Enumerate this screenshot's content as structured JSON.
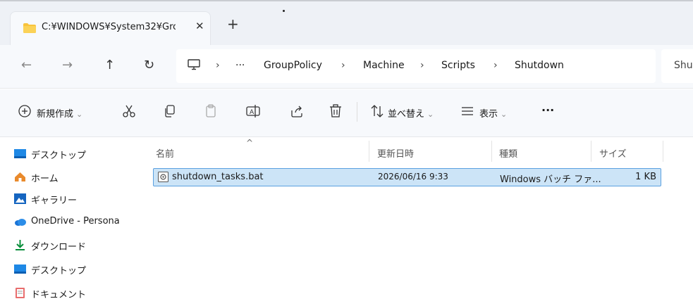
{
  "tab": {
    "title": "C:¥WINDOWS¥System32¥Gro",
    "close_glyph": "✕",
    "new_tab_glyph": "+",
    "icon": "folder-icon"
  },
  "nav": {
    "back_glyph": "←",
    "forward_glyph": "→",
    "up_glyph": "↑",
    "refresh_glyph": "↻",
    "more_glyph": "···",
    "breadcrumbs": [
      "GroupPolicy",
      "Machine",
      "Scripts",
      "Shutdown"
    ],
    "separator": "›",
    "search_placeholder": "Shu"
  },
  "toolbar": {
    "new_label": "新規作成",
    "sort_label": "並べ替え",
    "view_label": "表示",
    "more_glyph": "···",
    "caret": "⌄"
  },
  "sidebar": {
    "items": [
      {
        "label": "デスクトップ",
        "icon": "desktop-icon"
      },
      {
        "label": "ホーム",
        "icon": "home-icon"
      },
      {
        "label": "ギャラリー",
        "icon": "gallery-icon"
      },
      {
        "label": "OneDrive - Persona",
        "icon": "onedrive-icon"
      },
      {
        "label": "ダウンロード",
        "icon": "download-icon"
      },
      {
        "label": "デスクトップ",
        "icon": "desktop-icon"
      },
      {
        "label": "ドキュメント",
        "icon": "documents-icon"
      }
    ]
  },
  "columns": {
    "name": "名前",
    "modified": "更新日時",
    "type": "種類",
    "size": "サイズ",
    "sort_caret": "^"
  },
  "files": [
    {
      "name": "shutdown_tasks.bat",
      "modified": "2026/06/16 9:33",
      "type": "Windows バッチ ファ...",
      "size": "1 KB",
      "icon": "batch-file-icon"
    }
  ],
  "colors": {
    "accent": "#0067c0",
    "selection_bg": "#cce4f7",
    "selection_border": "#5aa0e0",
    "folder": "#f8c33c"
  }
}
